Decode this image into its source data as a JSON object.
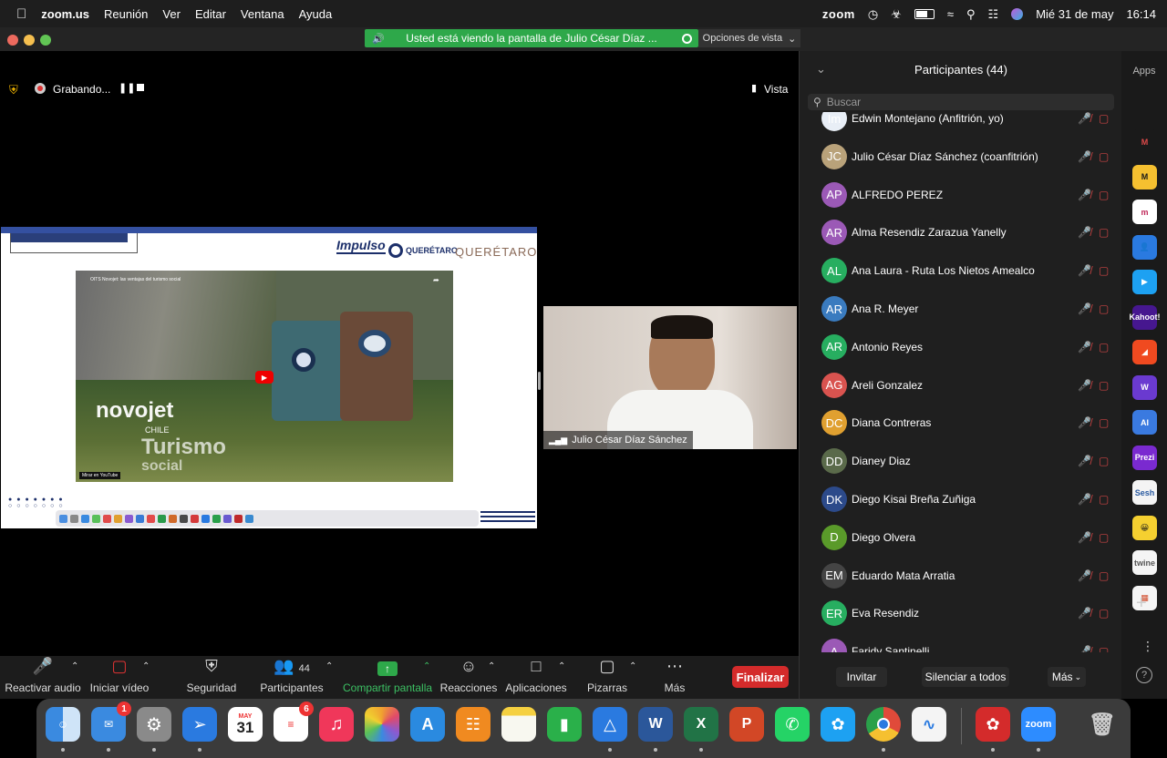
{
  "menubar": {
    "app": "zoom.us",
    "items": [
      "Reunión",
      "Ver",
      "Editar",
      "Ventana",
      "Ayuda"
    ],
    "zoom_label": "zoom",
    "datetime_day": "Mié 31 de may",
    "datetime_time": "16:14"
  },
  "banner": {
    "text": "Usted está viendo la pantalla de Julio César Díaz ...",
    "view_options": "Opciones de vista"
  },
  "recording": {
    "label": "Grabando...",
    "view_label": "Vista"
  },
  "speaker": {
    "name": "Julio César Díaz Sánchez"
  },
  "shared": {
    "brand1": "Impulso",
    "brand2": "QUERÉTARO",
    "brand3": "QUERÉTARO",
    "video_title": "OITS Novojet: las ventajas del turismo social",
    "video_watermark1": "novojet",
    "video_watermark_sub": "CHILE",
    "video_watermark2": "Turismo",
    "video_watermark3": "social",
    "video_source": "Mirar en YouTube"
  },
  "toolbar": {
    "audio": "Reactivar audio",
    "video": "Iniciar vídeo",
    "security": "Seguridad",
    "participants": "Participantes",
    "participants_count": "44",
    "share": "Compartir pantalla",
    "reactions": "Reacciones",
    "apps": "Aplicaciones",
    "whiteboards": "Pizarras",
    "more": "Más",
    "end": "Finalizar"
  },
  "panel": {
    "title": "Participantes (44)",
    "search_placeholder": "Buscar",
    "invite": "Invitar",
    "mute_all": "Silenciar a todos",
    "more": "Más",
    "apps_label": "Apps",
    "participants": [
      {
        "initials": "Im",
        "name": "Edwin Montejano (Anfitrión, yo)",
        "color": "#e8eef6"
      },
      {
        "initials": "JC",
        "name": "Julio César Díaz Sánchez (coanfitrión)",
        "color": "#b9a27a"
      },
      {
        "initials": "AP",
        "name": "ALFREDO PEREZ",
        "color": "#9b59b6"
      },
      {
        "initials": "AR",
        "name": "Alma Resendiz Zarazua Yanelly",
        "color": "#9b59b6"
      },
      {
        "initials": "AL",
        "name": "Ana Laura - Ruta Los Nietos Amealco",
        "color": "#27ae60"
      },
      {
        "initials": "AR",
        "name": "Ana R. Meyer",
        "color": "#3a7bbf"
      },
      {
        "initials": "AR",
        "name": "Antonio Reyes",
        "color": "#27ae60"
      },
      {
        "initials": "AG",
        "name": "Areli Gonzalez",
        "color": "#d9534f"
      },
      {
        "initials": "DC",
        "name": "Diana Contreras",
        "color": "#e0a030"
      },
      {
        "initials": "DD",
        "name": "Dianey Diaz",
        "color": "#5a6a4a"
      },
      {
        "initials": "DK",
        "name": "Diego Kisai Breña Zuñiga",
        "color": "#2c4a8a"
      },
      {
        "initials": "D",
        "name": "Diego Olvera",
        "color": "#5a9a2a"
      },
      {
        "initials": "EM",
        "name": "Eduardo Mata Arratia",
        "color": "#444"
      },
      {
        "initials": "ER",
        "name": "Eva Resendiz",
        "color": "#27ae60"
      },
      {
        "initials": "A",
        "name": "Faridy Santinelli",
        "color": "#9b59b6"
      }
    ]
  },
  "apps_sidebar": [
    "M",
    "M",
    "m",
    "👤",
    "▶",
    "Kahoot!",
    "◢",
    "W",
    "AI",
    "Prezi",
    "Sesh",
    "😀",
    "twine",
    "▦"
  ],
  "dock": {
    "calendar_month": "MAY",
    "calendar_day": "31",
    "mail_badge": "1",
    "reminders_badge": "6",
    "zoom_label": "zoom"
  }
}
